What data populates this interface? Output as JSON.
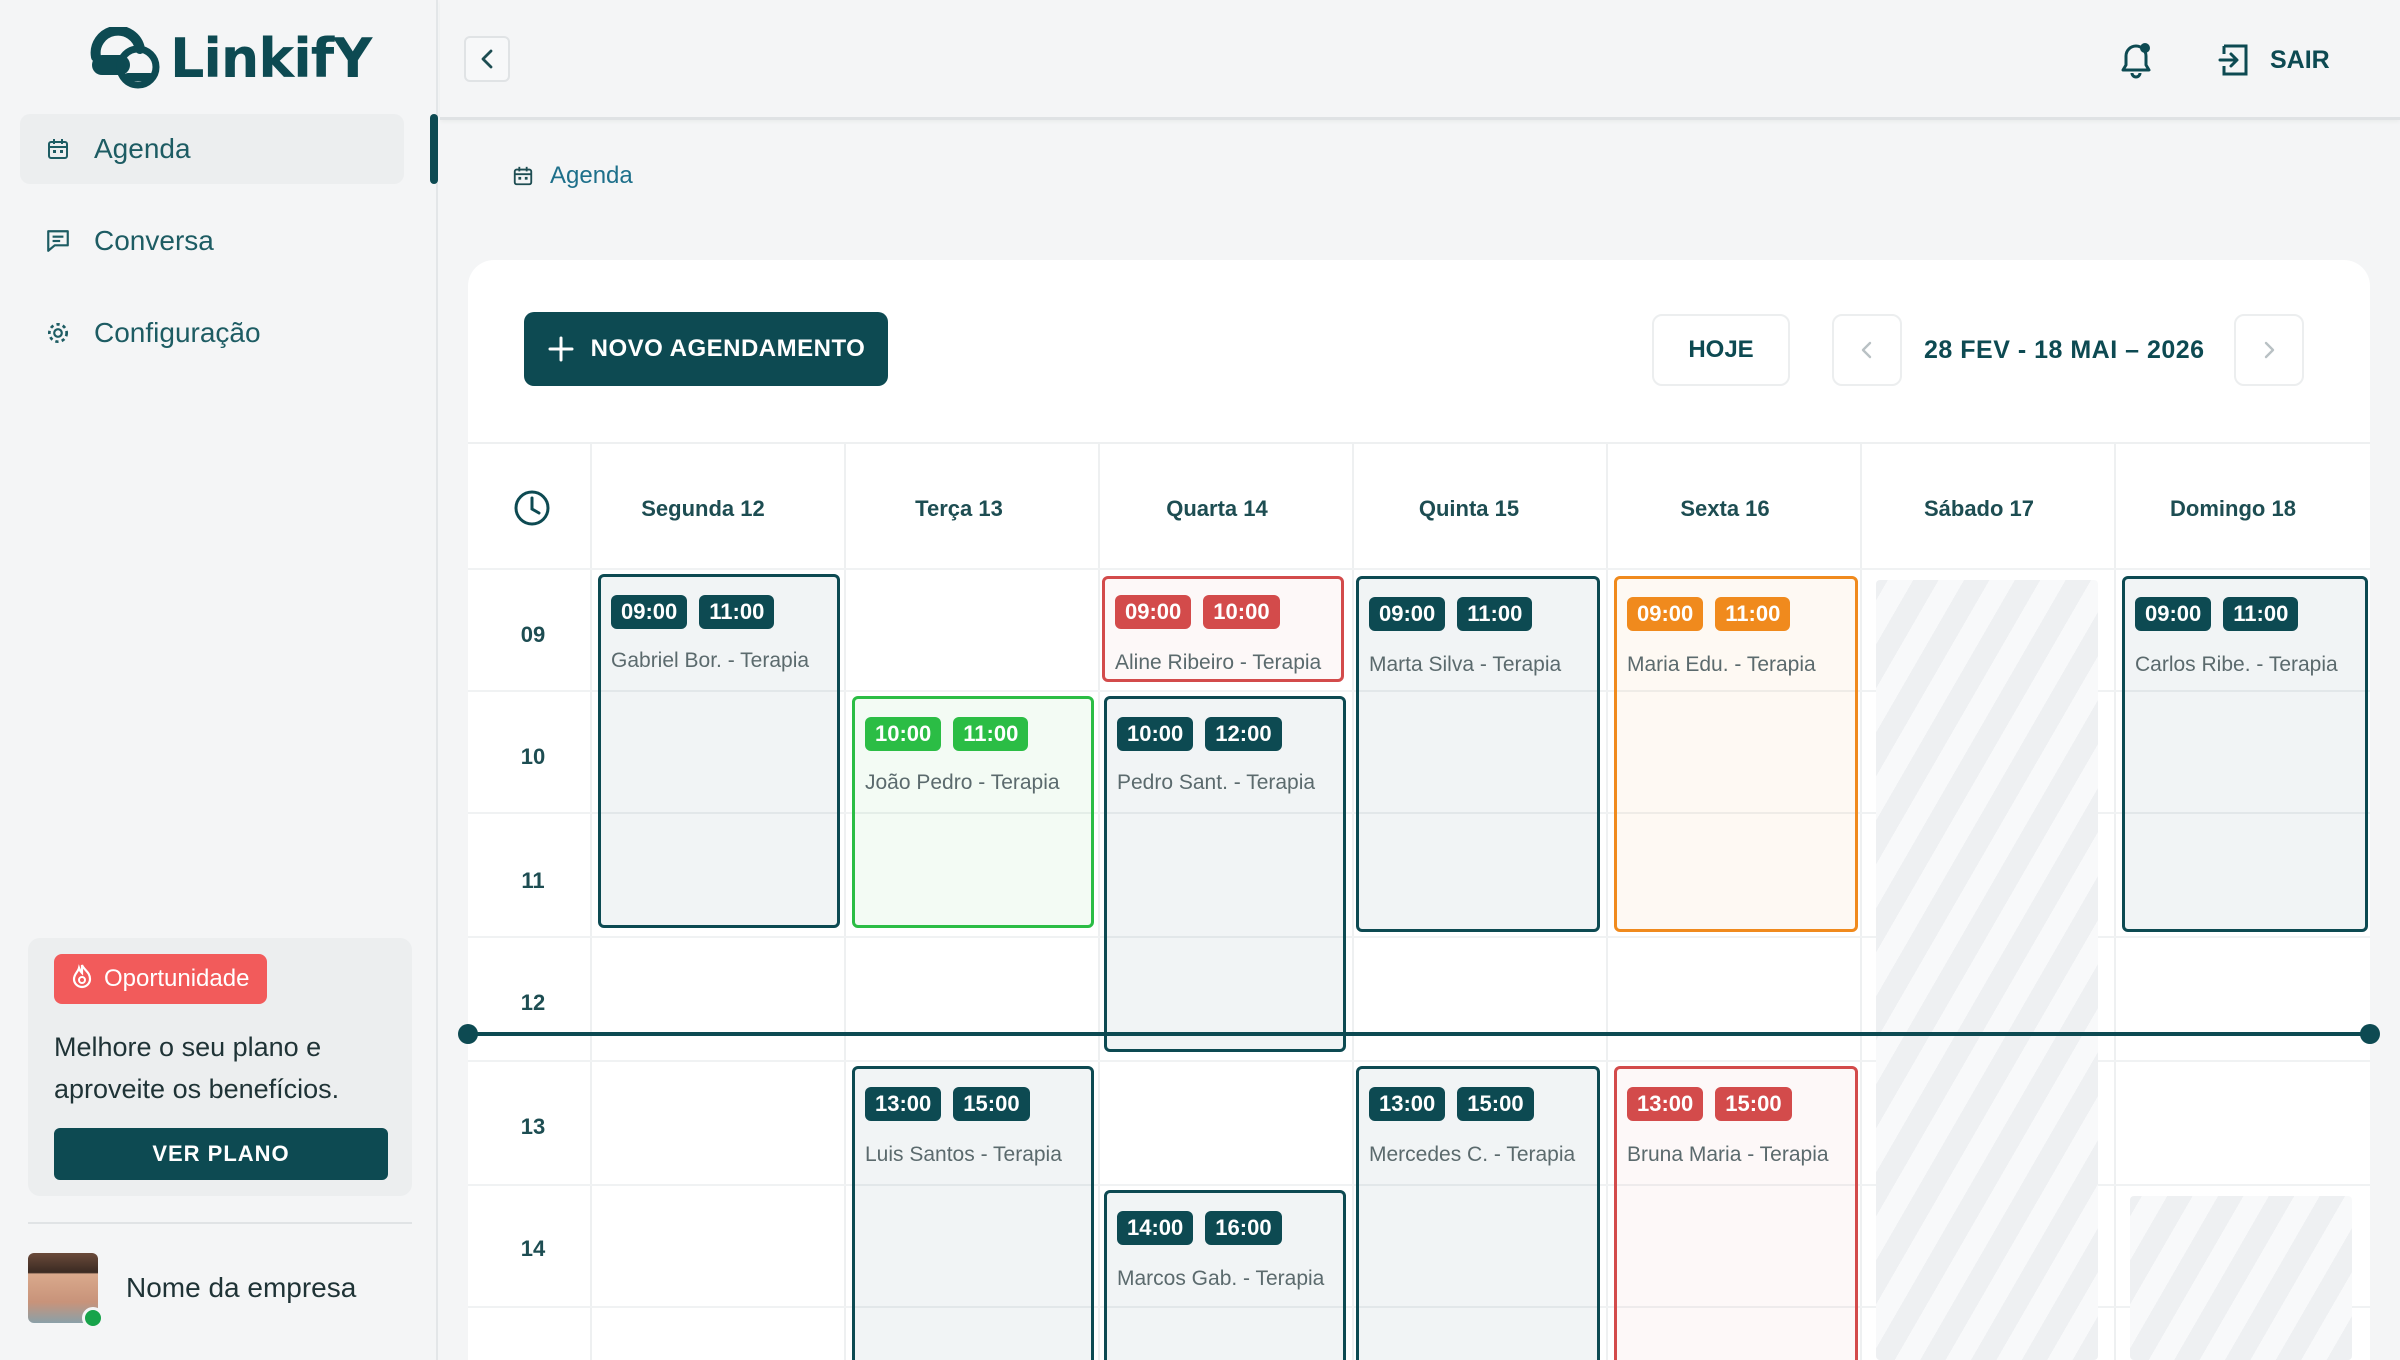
{
  "app": {
    "brand": "LinkifY"
  },
  "sidebar": {
    "items": [
      {
        "label": "Agenda",
        "icon": "calendar-icon"
      },
      {
        "label": "Conversa",
        "icon": "chat-icon"
      },
      {
        "label": "Configuração",
        "icon": "gear-icon"
      }
    ],
    "promo": {
      "badge": "Oportunidade",
      "text": "Melhore o seu plano e aproveite os benefícios.",
      "button": "VER PLANO"
    },
    "company": "Nome da empresa"
  },
  "header": {
    "logout": "SAIR"
  },
  "breadcrumb": {
    "label": "Agenda"
  },
  "toolbar": {
    "new_button": "NOVO AGENDAMENTO",
    "today_button": "HOJE",
    "date_range": "28 FEV - 18 MAI – 2026"
  },
  "calendar": {
    "days": [
      "Segunda 12",
      "Terça 13",
      "Quarta 14",
      "Quinta 15",
      "Sexta 16",
      "Sábado 17",
      "Domingo 18"
    ],
    "hours": [
      "09",
      "10",
      "11",
      "12",
      "13",
      "14"
    ],
    "events": [
      {
        "start": "09:00",
        "end": "11:00",
        "title": "Gabriel Bor. - Terapia"
      },
      {
        "start": "10:00",
        "end": "11:00",
        "title": "João Pedro - Terapia"
      },
      {
        "start": "09:00",
        "end": "10:00",
        "title": "Aline Ribeiro - Terapia"
      },
      {
        "start": "10:00",
        "end": "12:00",
        "title": "Pedro Sant. - Terapia"
      },
      {
        "start": "09:00",
        "end": "11:00",
        "title": "Marta Silva - Terapia"
      },
      {
        "start": "09:00",
        "end": "11:00",
        "title": "Maria Edu. - Terapia"
      },
      {
        "start": "09:00",
        "end": "11:00",
        "title": "Carlos Ribe. - Terapia"
      },
      {
        "start": "13:00",
        "end": "15:00",
        "title": "Luis Santos - Terapia"
      },
      {
        "start": "14:00",
        "end": "16:00",
        "title": "Marcos Gab. - Terapia"
      },
      {
        "start": "13:00",
        "end": "15:00",
        "title": "Mercedes C. - Terapia"
      },
      {
        "start": "13:00",
        "end": "15:00",
        "title": "Bruna Maria - Terapia"
      }
    ]
  },
  "colors": {
    "primary": "#0d4a52",
    "green": "#2bbd45",
    "red": "#d34b4b",
    "orange": "#f08a1d",
    "promo_badge": "#f25b5b"
  }
}
